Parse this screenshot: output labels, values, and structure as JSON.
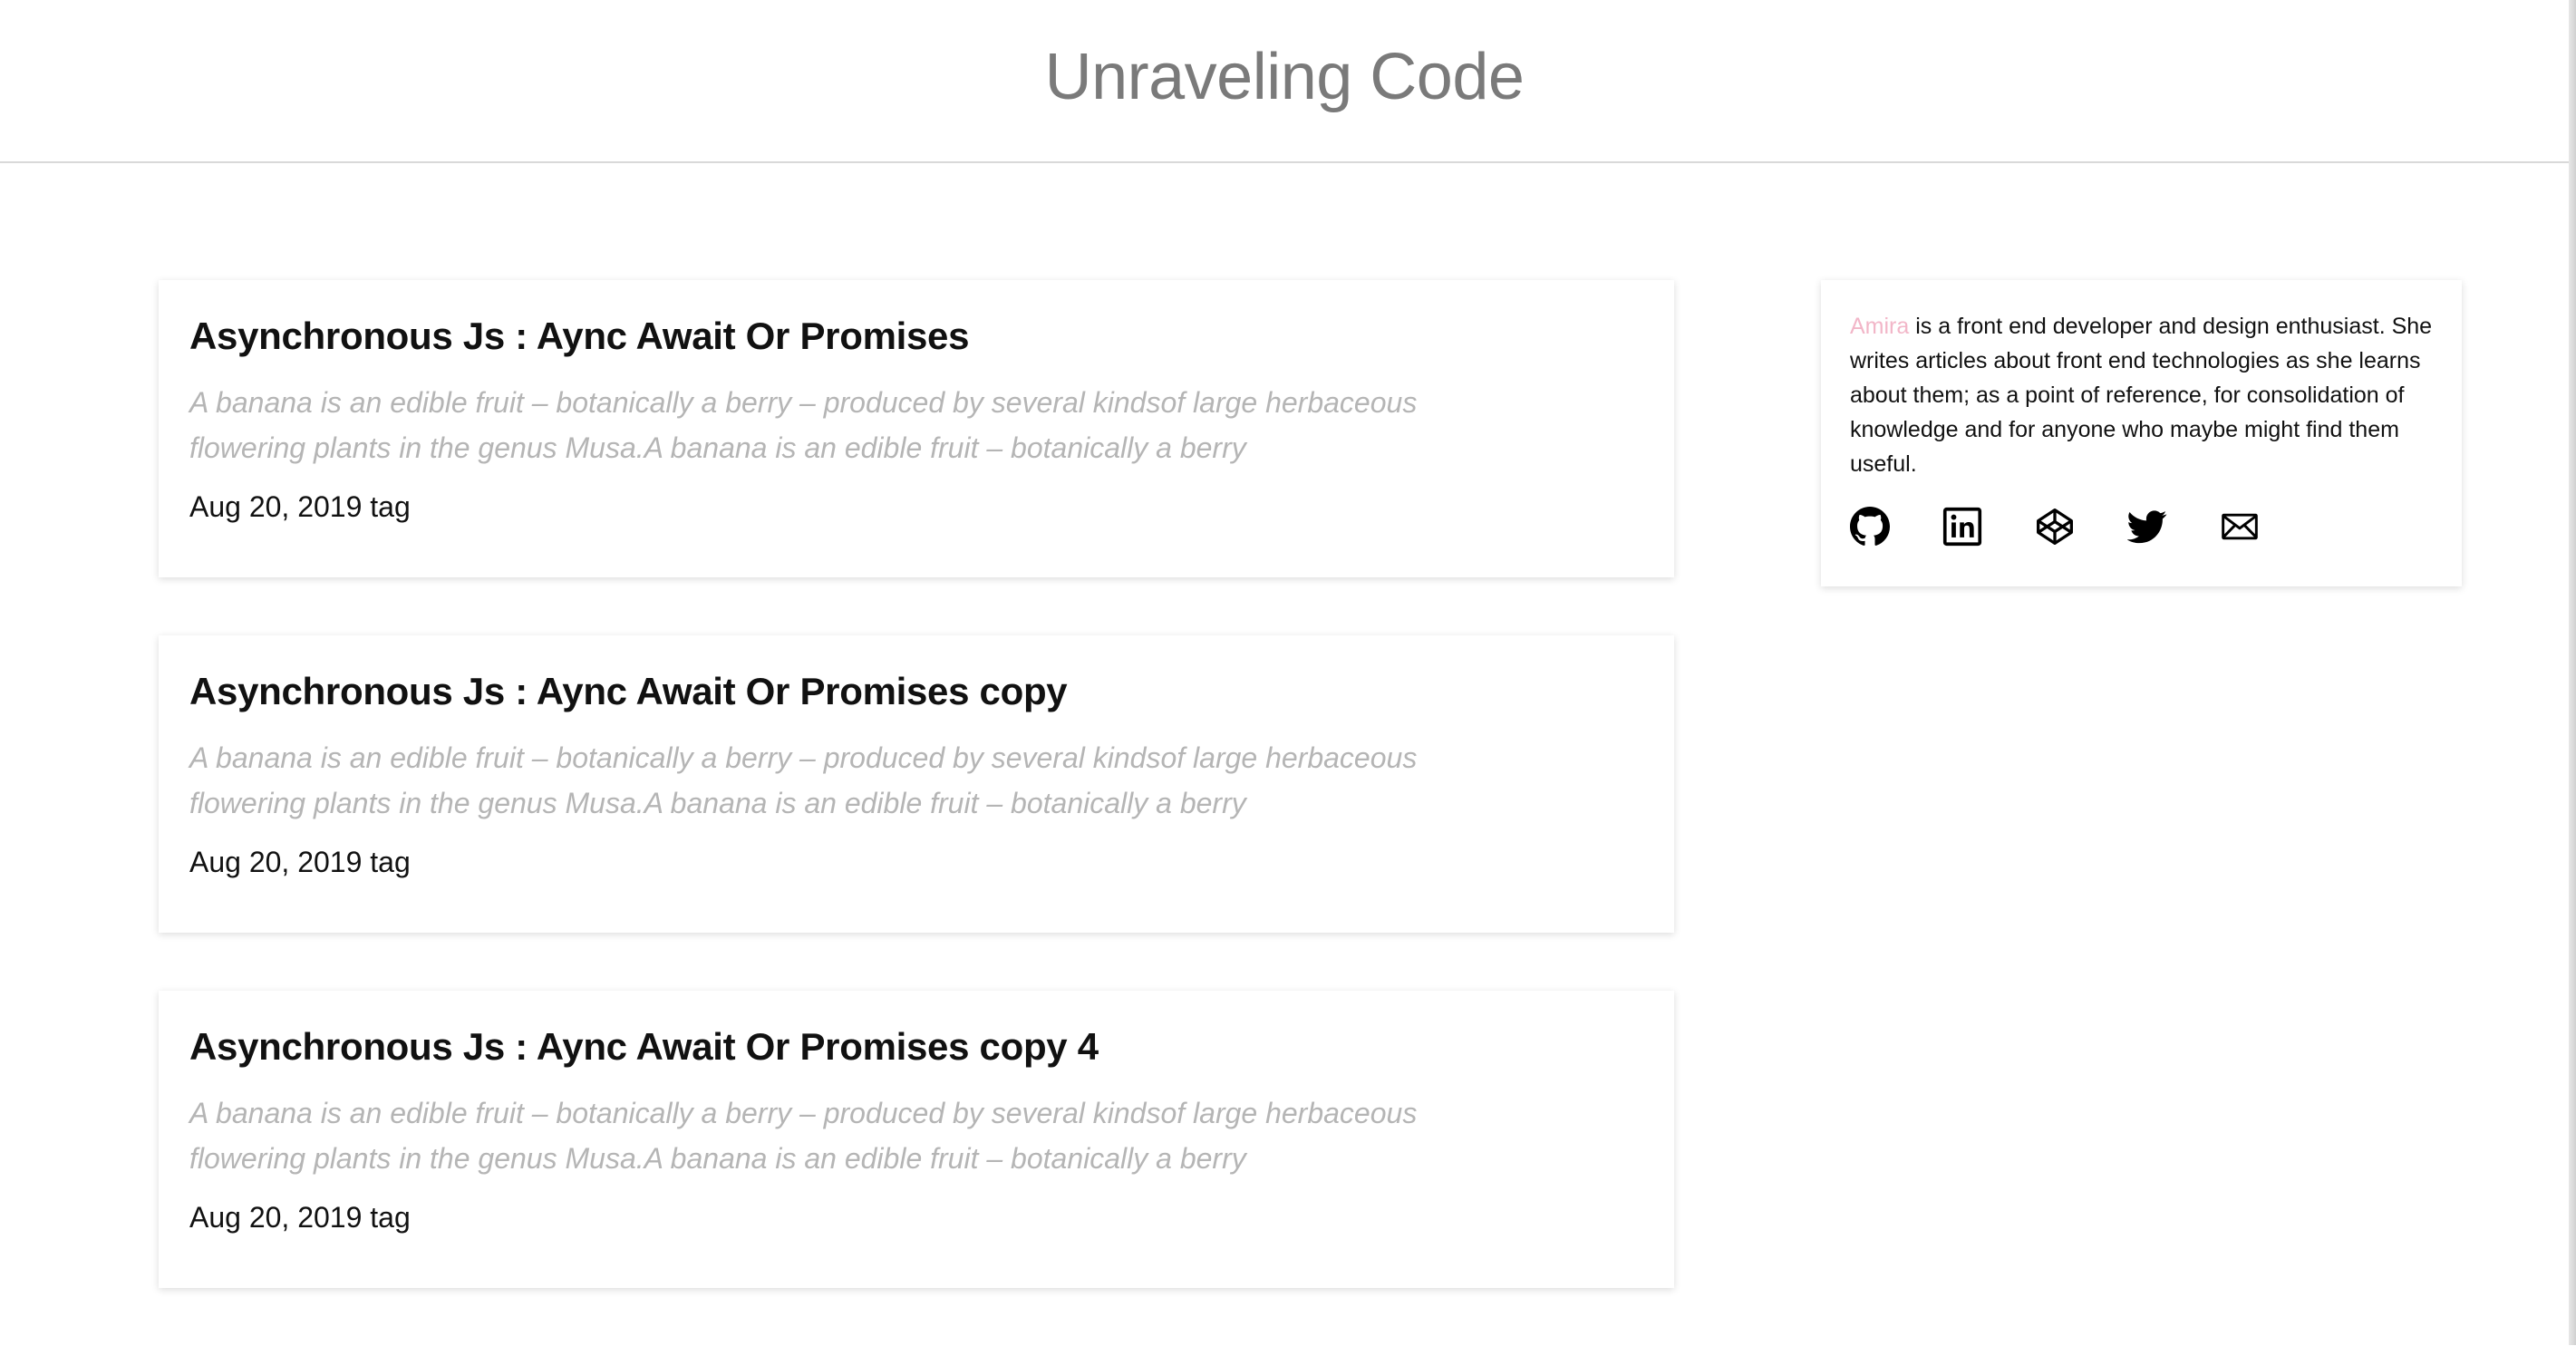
{
  "header": {
    "title": "Unraveling Code"
  },
  "posts": [
    {
      "title": "Asynchronous Js : Aync Await Or Promises",
      "excerpt": "A banana is an edible fruit – botanically a berry – produced by several kindsof large herbaceous flowering plants in the genus Musa.A banana is an edible fruit – botanically a berry",
      "meta": "Aug 20, 2019 tag"
    },
    {
      "title": "Asynchronous Js : Aync Await Or Promises copy",
      "excerpt": "A banana is an edible fruit – botanically a berry – produced by several kindsof large herbaceous flowering plants in the genus Musa.A banana is an edible fruit – botanically a berry",
      "meta": "Aug 20, 2019 tag"
    },
    {
      "title": "Asynchronous Js : Aync Await Or Promises copy 4",
      "excerpt": "A banana is an edible fruit – botanically a berry – produced by several kindsof large herbaceous flowering plants in the genus Musa.A banana is an edible fruit – botanically a berry",
      "meta": "Aug 20, 2019 tag"
    }
  ],
  "about": {
    "author_name": "Amira",
    "bio": " is a front end developer and design enthusiast. She writes articles about front end technologies as she learns about them; as a point of reference, for consolidation of knowledge and for anyone who maybe might find them useful."
  },
  "social": {
    "icons": [
      "github-icon",
      "linkedin-icon",
      "codepen-icon",
      "twitter-icon",
      "mail-icon"
    ]
  },
  "colors": {
    "title_gray": "#7a7a7a",
    "excerpt_gray": "#b5b5b5",
    "accent_pink": "#f2b6c8"
  }
}
